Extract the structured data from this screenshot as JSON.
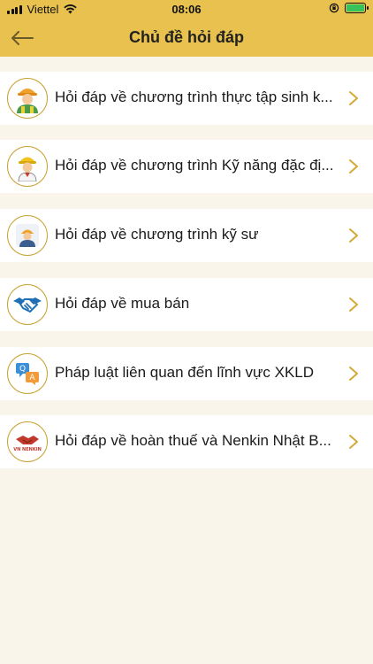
{
  "status": {
    "carrier": "Viettel",
    "time": "08:06"
  },
  "header": {
    "title": "Chủ đề hỏi đáp",
    "back_icon": "back-arrow-icon"
  },
  "topics": [
    {
      "label": "Hỏi đáp về chương trình thực tập sinh k...",
      "icon": "worker-green-vest-icon"
    },
    {
      "label": "Hỏi đáp về chương trình Kỹ năng đặc đị...",
      "icon": "worker-yellow-helmet-icon"
    },
    {
      "label": "Hỏi đáp về chương trình kỹ sư",
      "icon": "engineer-icon"
    },
    {
      "label": "Hỏi đáp về mua bán",
      "icon": "handshake-icon"
    },
    {
      "label": "Pháp luật liên quan đến lĩnh vực XKLD",
      "icon": "qa-chat-icon"
    },
    {
      "label": "Hỏi đáp về hoàn thuế và Nenkin Nhật B...",
      "icon": "vn-nenkin-logo-icon"
    }
  ],
  "colors": {
    "header_bg": "#e8c14e",
    "accent": "#d4a935",
    "page_bg": "#faf5ea"
  }
}
